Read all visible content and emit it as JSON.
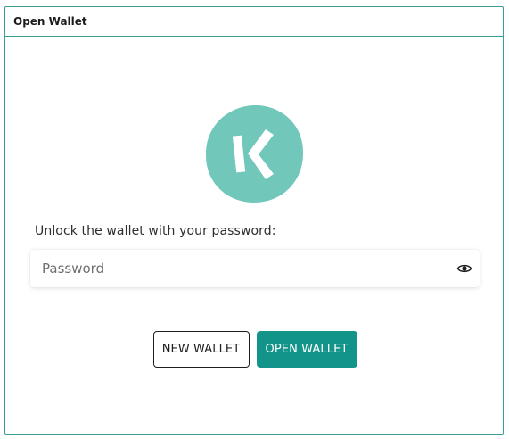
{
  "panel": {
    "title": "Open Wallet"
  },
  "logo": {
    "icon": "kaspa-logo-icon",
    "color": "#70c7ba"
  },
  "unlock": {
    "prompt": "Unlock the wallet with your password:",
    "password_placeholder": "Password",
    "password_value": "",
    "toggle_icon": "eye-icon"
  },
  "buttons": {
    "new_wallet": "NEW WALLET",
    "open_wallet": "OPEN WALLET"
  },
  "colors": {
    "accent": "#12948a",
    "border": "#3a9e96"
  }
}
